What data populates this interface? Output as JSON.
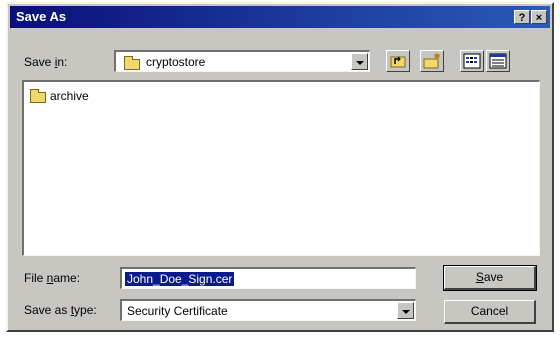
{
  "window": {
    "title": "Save As",
    "help_label": "?",
    "close_label": "×"
  },
  "save_in": {
    "label_pre": "Save ",
    "label_key": "i",
    "label_post": "n:",
    "value": "cryptostore"
  },
  "files": [
    {
      "name": "archive",
      "icon": "folder-icon"
    }
  ],
  "file_name": {
    "label_pre": "File ",
    "label_key": "n",
    "label_post": "ame:",
    "value": "John_Doe_Sign.cer"
  },
  "save_as_type": {
    "label_pre": "Save as ",
    "label_key": "t",
    "label_post": "ype:",
    "value": "Security Certificate"
  },
  "buttons": {
    "save_key": "S",
    "save_rest": "ave",
    "cancel": "Cancel"
  },
  "icons": {
    "up_one_level": "up-folder-icon",
    "new_folder": "new-folder-icon",
    "list_view": "list-view-icon",
    "details_view": "details-view-icon"
  }
}
